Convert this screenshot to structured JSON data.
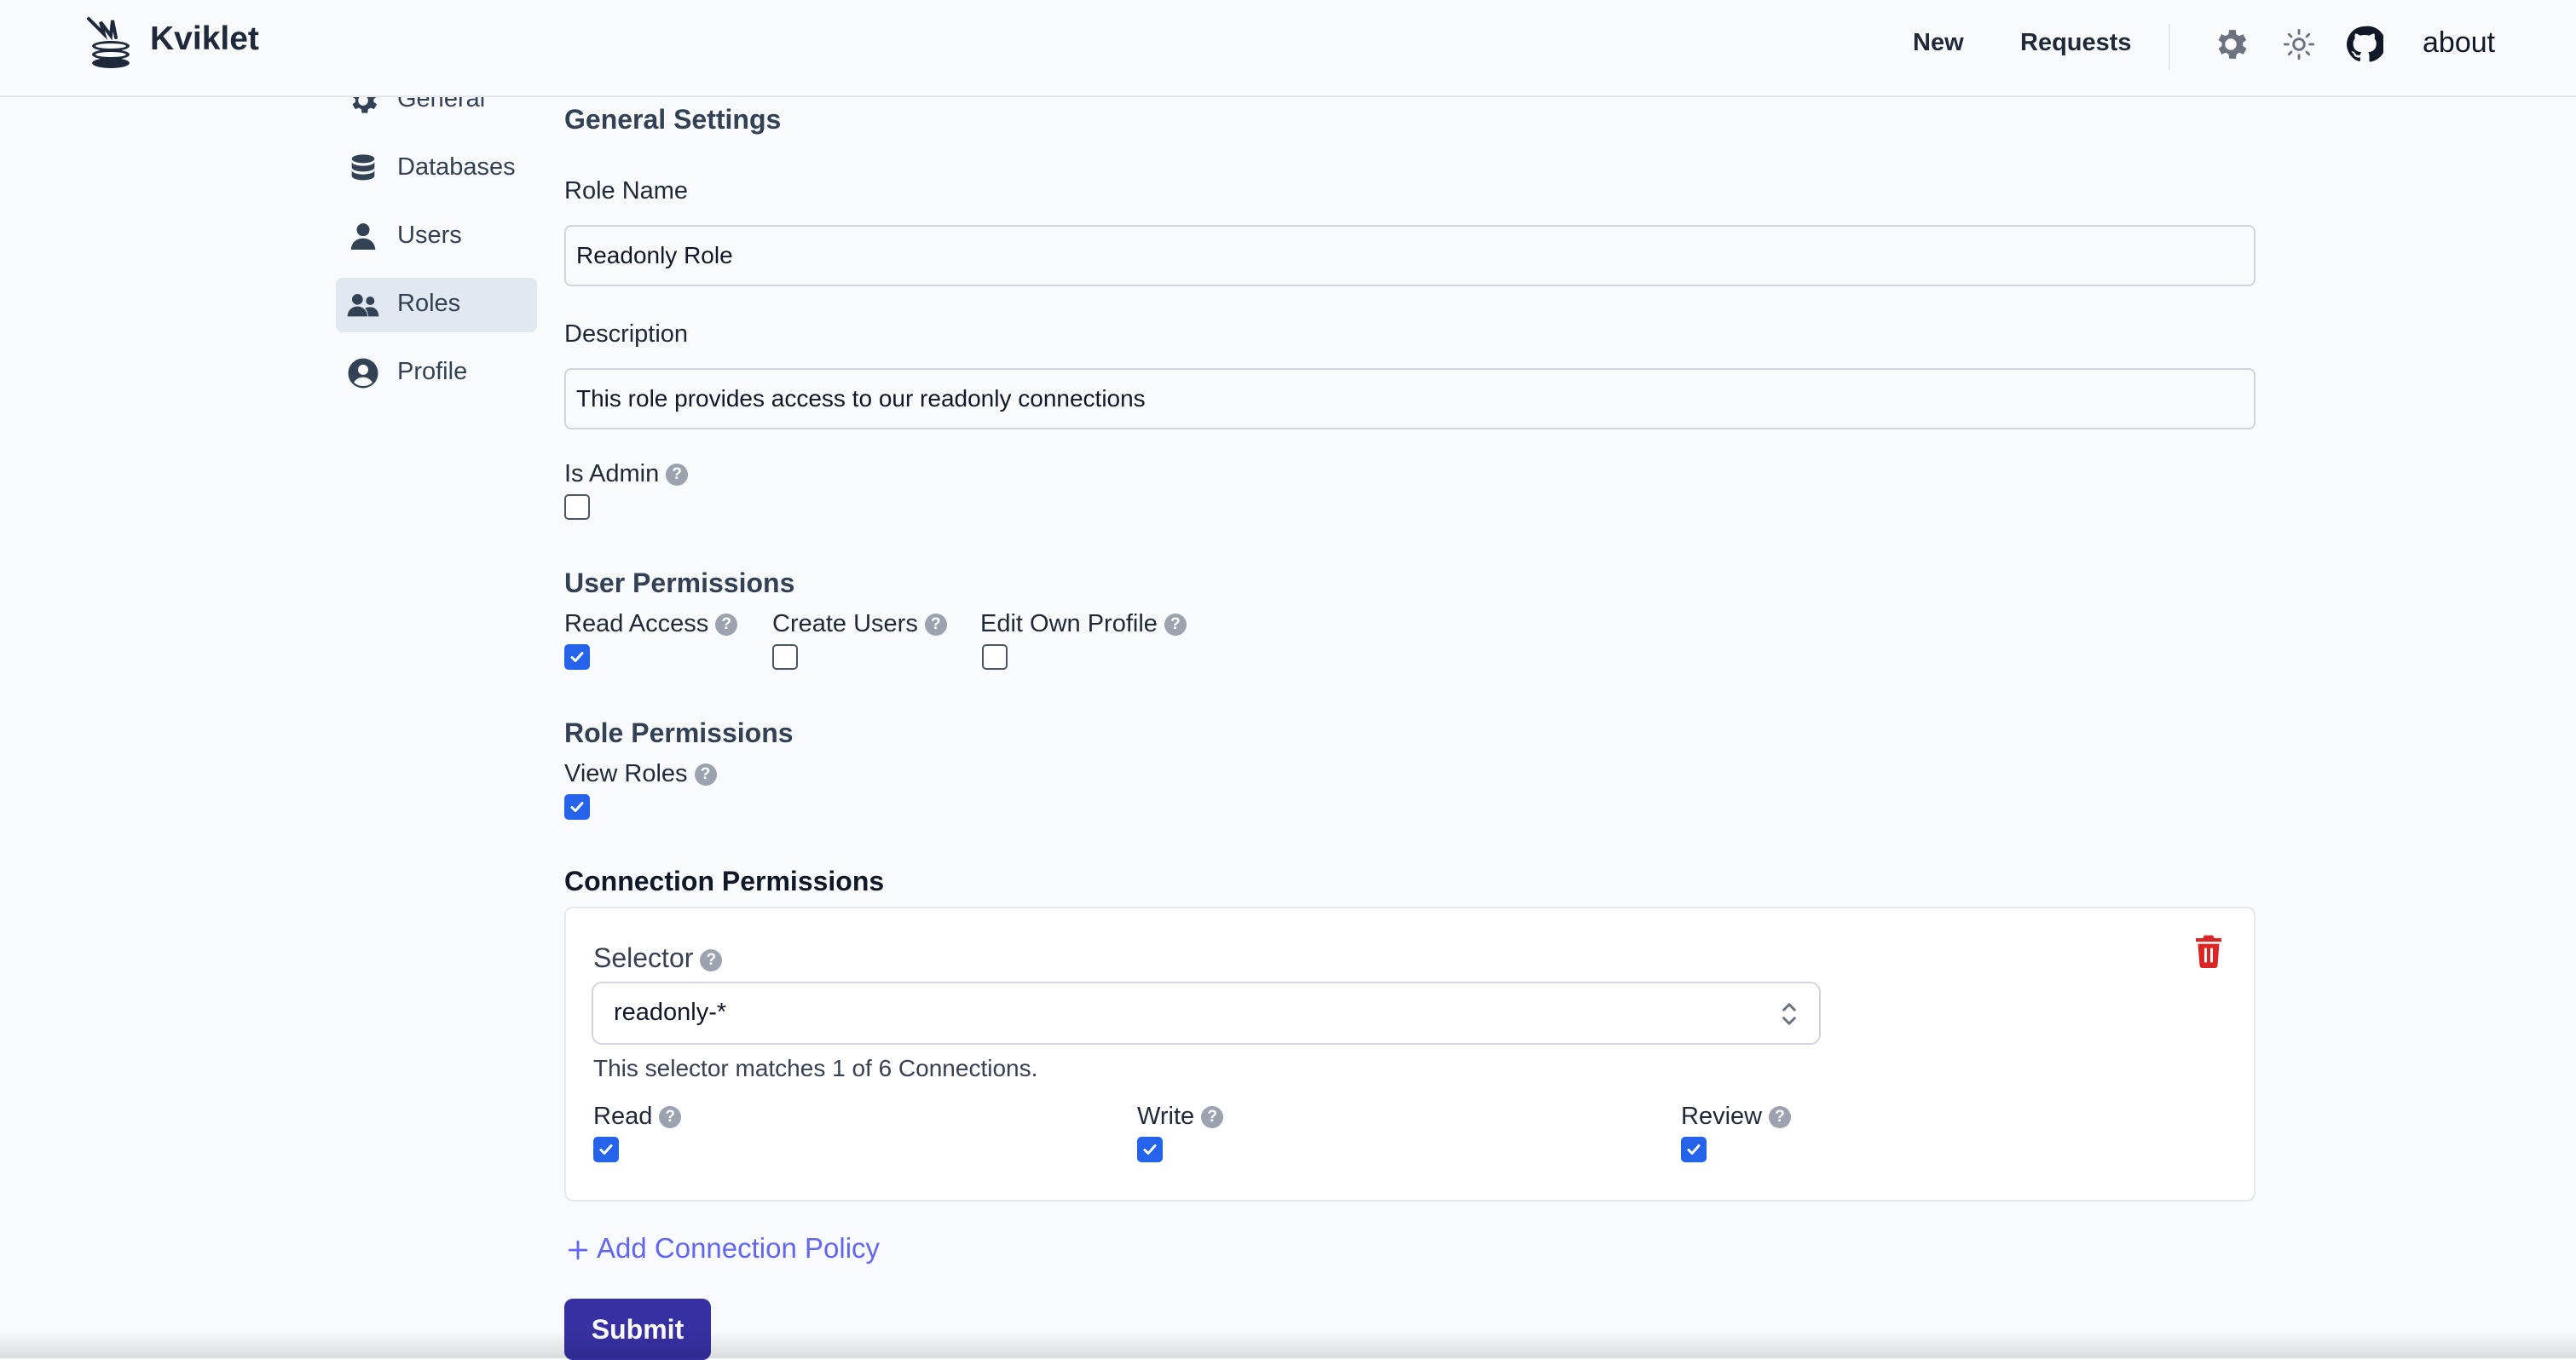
{
  "app": {
    "brand": "Kviklet"
  },
  "nav": {
    "new": "New",
    "requests": "Requests",
    "about": "about",
    "icons": [
      "gear-icon",
      "sun-icon",
      "github-icon"
    ]
  },
  "sidebar": {
    "items": [
      {
        "label": "General",
        "icon": "gear-icon"
      },
      {
        "label": "Databases",
        "icon": "database-icon"
      },
      {
        "label": "Users",
        "icon": "user-icon"
      },
      {
        "label": "Roles",
        "icon": "users-icon",
        "active": true
      },
      {
        "label": "Profile",
        "icon": "user-circle-icon"
      }
    ]
  },
  "form": {
    "heading": "General Settings",
    "role_name_label": "Role Name",
    "role_name_value": "Readonly Role",
    "description_label": "Description",
    "description_value": "This role provides access to our readonly connections",
    "is_admin_label": "Is Admin",
    "is_admin": false,
    "user_permissions": {
      "heading": "User Permissions",
      "read_access_label": "Read Access",
      "read_access": true,
      "create_users_label": "Create Users",
      "create_users": false,
      "edit_own_profile_label": "Edit Own Profile",
      "edit_own_profile": false
    },
    "role_permissions": {
      "heading": "Role Permissions",
      "view_roles_label": "View Roles",
      "view_roles": true
    },
    "connection_permissions": {
      "heading": "Connection Permissions",
      "selector_label": "Selector",
      "selector_value": "readonly-*",
      "match_text": "This selector matches 1 of 6 Connections.",
      "read_label": "Read",
      "read": true,
      "write_label": "Write",
      "write": true,
      "review_label": "Review",
      "review": true
    },
    "add_policy_label": "Add Connection Policy",
    "submit_label": "Submit"
  },
  "colors": {
    "accent": "#3730a3",
    "link": "#6366f1",
    "checkbox": "#2563eb",
    "delete": "#dc2626"
  }
}
